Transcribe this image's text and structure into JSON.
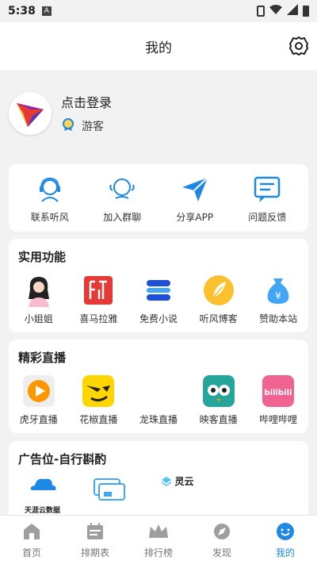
{
  "status": {
    "time": "5:38",
    "notif_icon": "a-icon"
  },
  "appbar": {
    "title": "我的"
  },
  "profile": {
    "login": "点击登录",
    "role": "游客"
  },
  "contact": {
    "items": [
      {
        "label": "联系听风",
        "icon": "headset-icon"
      },
      {
        "label": "加入群聊",
        "icon": "group-chat-icon"
      },
      {
        "label": "分享APP",
        "icon": "share-plane-icon"
      },
      {
        "label": "问题反馈",
        "icon": "feedback-icon"
      }
    ]
  },
  "tools": {
    "title": "实用功能",
    "items": [
      {
        "label": "小姐姐",
        "icon": "girl-icon"
      },
      {
        "label": "喜马拉雅",
        "icon": "ximalaya-icon"
      },
      {
        "label": "免费小说",
        "icon": "novel-icon"
      },
      {
        "label": "听风博客",
        "icon": "feather-icon"
      },
      {
        "label": "赞助本站",
        "icon": "money-bag-icon"
      }
    ]
  },
  "live": {
    "title": "精彩直播",
    "items": [
      {
        "label": "虎牙直播",
        "icon": "huya-icon"
      },
      {
        "label": "花椒直播",
        "icon": "huajiao-icon"
      },
      {
        "label": "龙珠直播",
        "icon": "longzhu-icon"
      },
      {
        "label": "映客直播",
        "icon": "inke-icon"
      },
      {
        "label": "哔哩哔哩",
        "icon": "bilibili-icon"
      }
    ]
  },
  "ads": {
    "title": "广告位-自行斟酌",
    "items": [
      {
        "label": "天涯云数据",
        "icon": "tianya-cloud-icon"
      },
      {
        "label": "",
        "icon": "cards-icon"
      },
      {
        "label": "灵云",
        "icon": "lingyun-icon"
      }
    ]
  },
  "nav": {
    "items": [
      {
        "label": "首页",
        "icon": "home-icon"
      },
      {
        "label": "排期表",
        "icon": "schedule-icon"
      },
      {
        "label": "排行榜",
        "icon": "crown-icon"
      },
      {
        "label": "发现",
        "icon": "discover-icon"
      },
      {
        "label": "我的",
        "icon": "me-icon"
      }
    ]
  },
  "colors": {
    "accent": "#1e88e5",
    "card": "#ffffff",
    "bg": "#f2f2f2"
  }
}
